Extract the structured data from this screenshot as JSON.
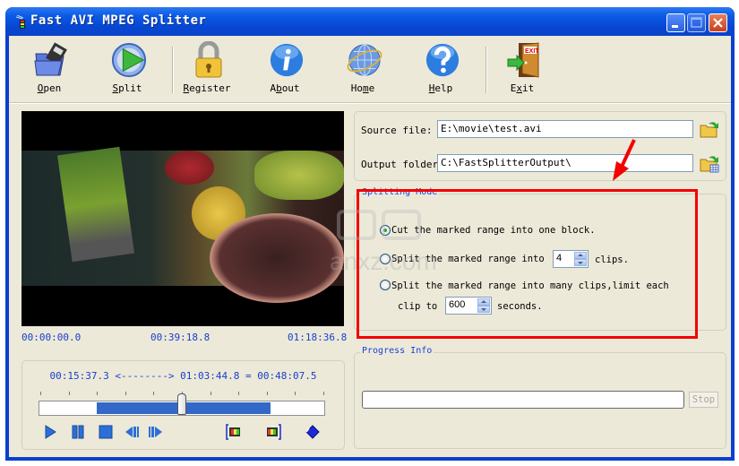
{
  "window": {
    "title": "Fast AVI MPEG Splitter",
    "controls": {
      "minimize": "minimize",
      "maximize": "maximize",
      "close": "close"
    }
  },
  "toolbar": {
    "items": [
      {
        "id": "open",
        "label": "Open",
        "accel": "O",
        "icon": "folder-film-icon"
      },
      {
        "id": "split",
        "label": "Split",
        "accel": "S",
        "icon": "play-circle-icon"
      },
      {
        "id": "register",
        "label": "Register",
        "accel": "R",
        "icon": "padlock-icon"
      },
      {
        "id": "about",
        "label": "About",
        "accel": "b",
        "icon": "info-icon"
      },
      {
        "id": "home",
        "label": "Home",
        "accel": "m",
        "icon": "globe-icon"
      },
      {
        "id": "help",
        "label": "Help",
        "accel": "H",
        "icon": "help-icon"
      },
      {
        "id": "exit",
        "label": "Exit",
        "accel": "x",
        "icon": "exit-door-icon"
      }
    ]
  },
  "player": {
    "times": {
      "start": "00:00:00.0",
      "middle": "00:39:18.8",
      "end": "01:18:36.8"
    },
    "range_text": "00:15:37.3 <--------> 01:03:44.8 = 00:48:07.5",
    "selection": {
      "start_fraction": 0.2,
      "end_fraction": 0.81
    },
    "position_fraction": 0.5,
    "controls": [
      "play",
      "pause",
      "stop",
      "step-back",
      "step-forward",
      "mark-in",
      "mark-out",
      "go-to-mark"
    ]
  },
  "files": {
    "source_label": "Source file:",
    "source_value": "E:\\movie\\test.avi",
    "output_label": "Output folder:",
    "output_value": "C:\\FastSplitterOutput\\"
  },
  "splitting_mode": {
    "title": "Splitting Mode",
    "options": [
      {
        "label": "Cut the marked range into one block.",
        "checked": true
      },
      {
        "label_before": "Split the marked range into",
        "value": "4",
        "label_after": "clips.",
        "checked": false
      },
      {
        "label_line1": "Split the marked range into many clips,limit each",
        "label_before": "clip to",
        "value": "600",
        "label_after": "seconds.",
        "checked": false
      }
    ]
  },
  "progress": {
    "title": "Progress Info",
    "value_percent": 0,
    "stop_label": "Stop"
  },
  "annotation": {
    "color": "#f40000"
  },
  "colors": {
    "titlebar": "#0b5ae5",
    "client_bg": "#ece9d8",
    "accent_text": "#1840d0",
    "selection": "#3368c9"
  }
}
